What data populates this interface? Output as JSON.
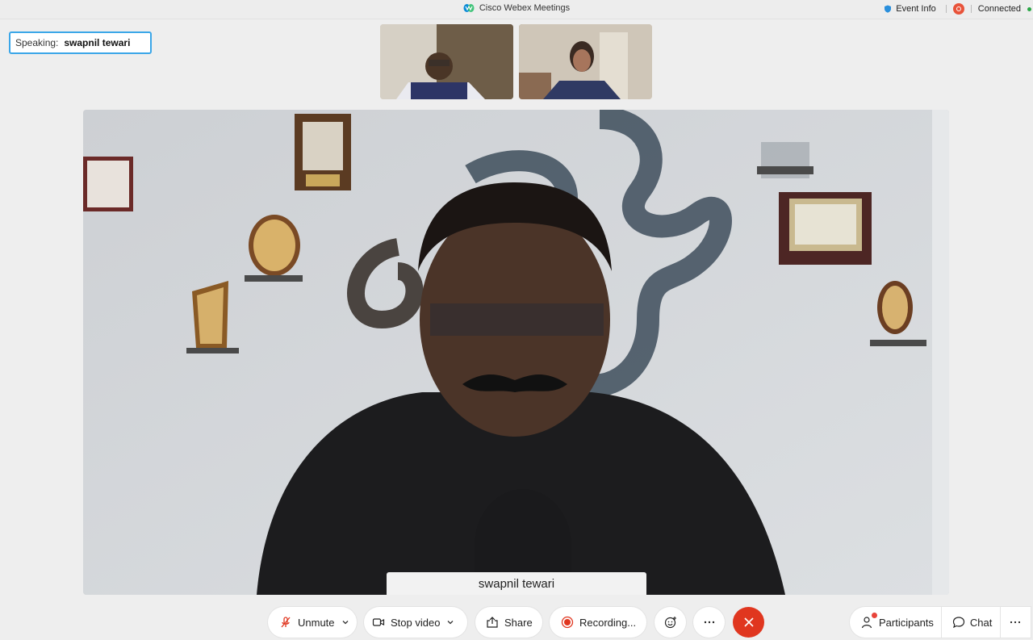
{
  "window": {
    "title": "Cisco Webex Meetings",
    "event_info": "Event Info",
    "status": "Connected"
  },
  "speaking": {
    "label": "Speaking:",
    "name": "swapnil tewari"
  },
  "main_video": {
    "participant_name": "swapnil tewari"
  },
  "controls": {
    "unmute": "Unmute",
    "stop_video": "Stop video",
    "share": "Share",
    "recording": "Recording...",
    "participants": "Participants",
    "chat": "Chat"
  },
  "icons": {
    "mic": "mic-muted-icon",
    "video": "video-camera-icon",
    "share": "share-icon",
    "record": "record-icon",
    "reactions": "smiley-icon",
    "more": "more-icon",
    "end": "end-call-icon",
    "participants": "person-icon",
    "chat": "chat-bubble-icon"
  },
  "colors": {
    "accent": "#3aa6e8",
    "end_call": "#e0361f",
    "recording": "#e8533a",
    "connected": "#29a745"
  }
}
